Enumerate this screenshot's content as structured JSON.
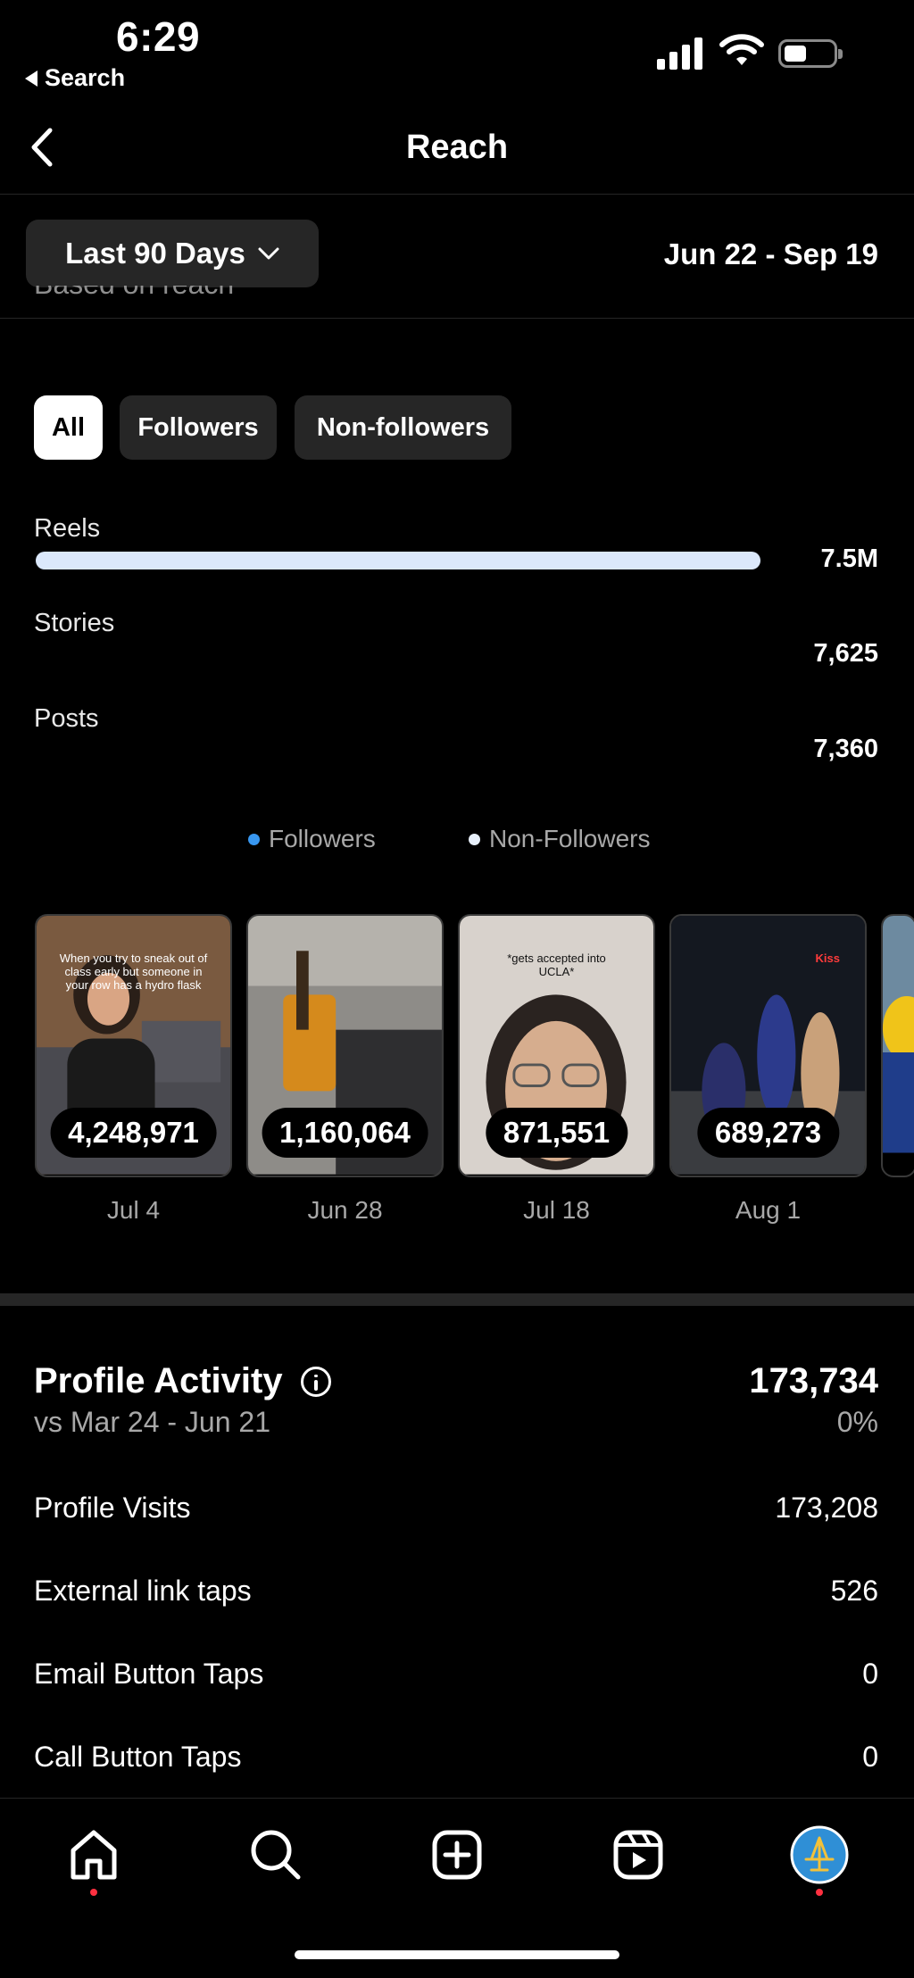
{
  "status_bar": {
    "time": "6:29",
    "back_app": "Search"
  },
  "header": {
    "title": "Reach"
  },
  "filter_bar": {
    "range_label": "Last 90 Days",
    "date_range": "Jun 22 - Sep 19"
  },
  "section_hint": "Based on reach",
  "content_filters": [
    {
      "label": "All",
      "active": true
    },
    {
      "label": "Followers",
      "active": false
    },
    {
      "label": "Non-followers",
      "active": false
    }
  ],
  "content_types": [
    {
      "label": "Reels",
      "value": "7.5M",
      "bar_fraction": 1.0
    },
    {
      "label": "Stories",
      "value": "7,625",
      "bar_fraction": 0.001
    },
    {
      "label": "Posts",
      "value": "7,360",
      "bar_fraction": 0.001
    }
  ],
  "legend": [
    {
      "label": "Followers",
      "color": "#3897f0"
    },
    {
      "label": "Non-Followers",
      "color": "#e8f0fb"
    }
  ],
  "top_content": [
    {
      "count": "4,248,971",
      "date": "Jul 4",
      "caption": "When you try to sneak out of class early but someone in your row has a hydro flask"
    },
    {
      "count": "1,160,064",
      "date": "Jun 28",
      "caption": ""
    },
    {
      "count": "871,551",
      "date": "Jul 18",
      "caption": "*gets accepted into UCLA*"
    },
    {
      "count": "689,273",
      "date": "Aug 1",
      "caption": "Kiss"
    }
  ],
  "profile_activity": {
    "title": "Profile Activity",
    "total": "173,734",
    "compare": "vs Mar 24 - Jun 21",
    "change": "0%",
    "rows": [
      {
        "label": "Profile Visits",
        "value": "173,208"
      },
      {
        "label": "External link taps",
        "value": "526"
      },
      {
        "label": "Email Button Taps",
        "value": "0"
      },
      {
        "label": "Call Button Taps",
        "value": "0"
      }
    ]
  },
  "tab_bar": [
    "home-icon",
    "search-icon",
    "create-icon",
    "reels-icon",
    "profile-avatar"
  ]
}
